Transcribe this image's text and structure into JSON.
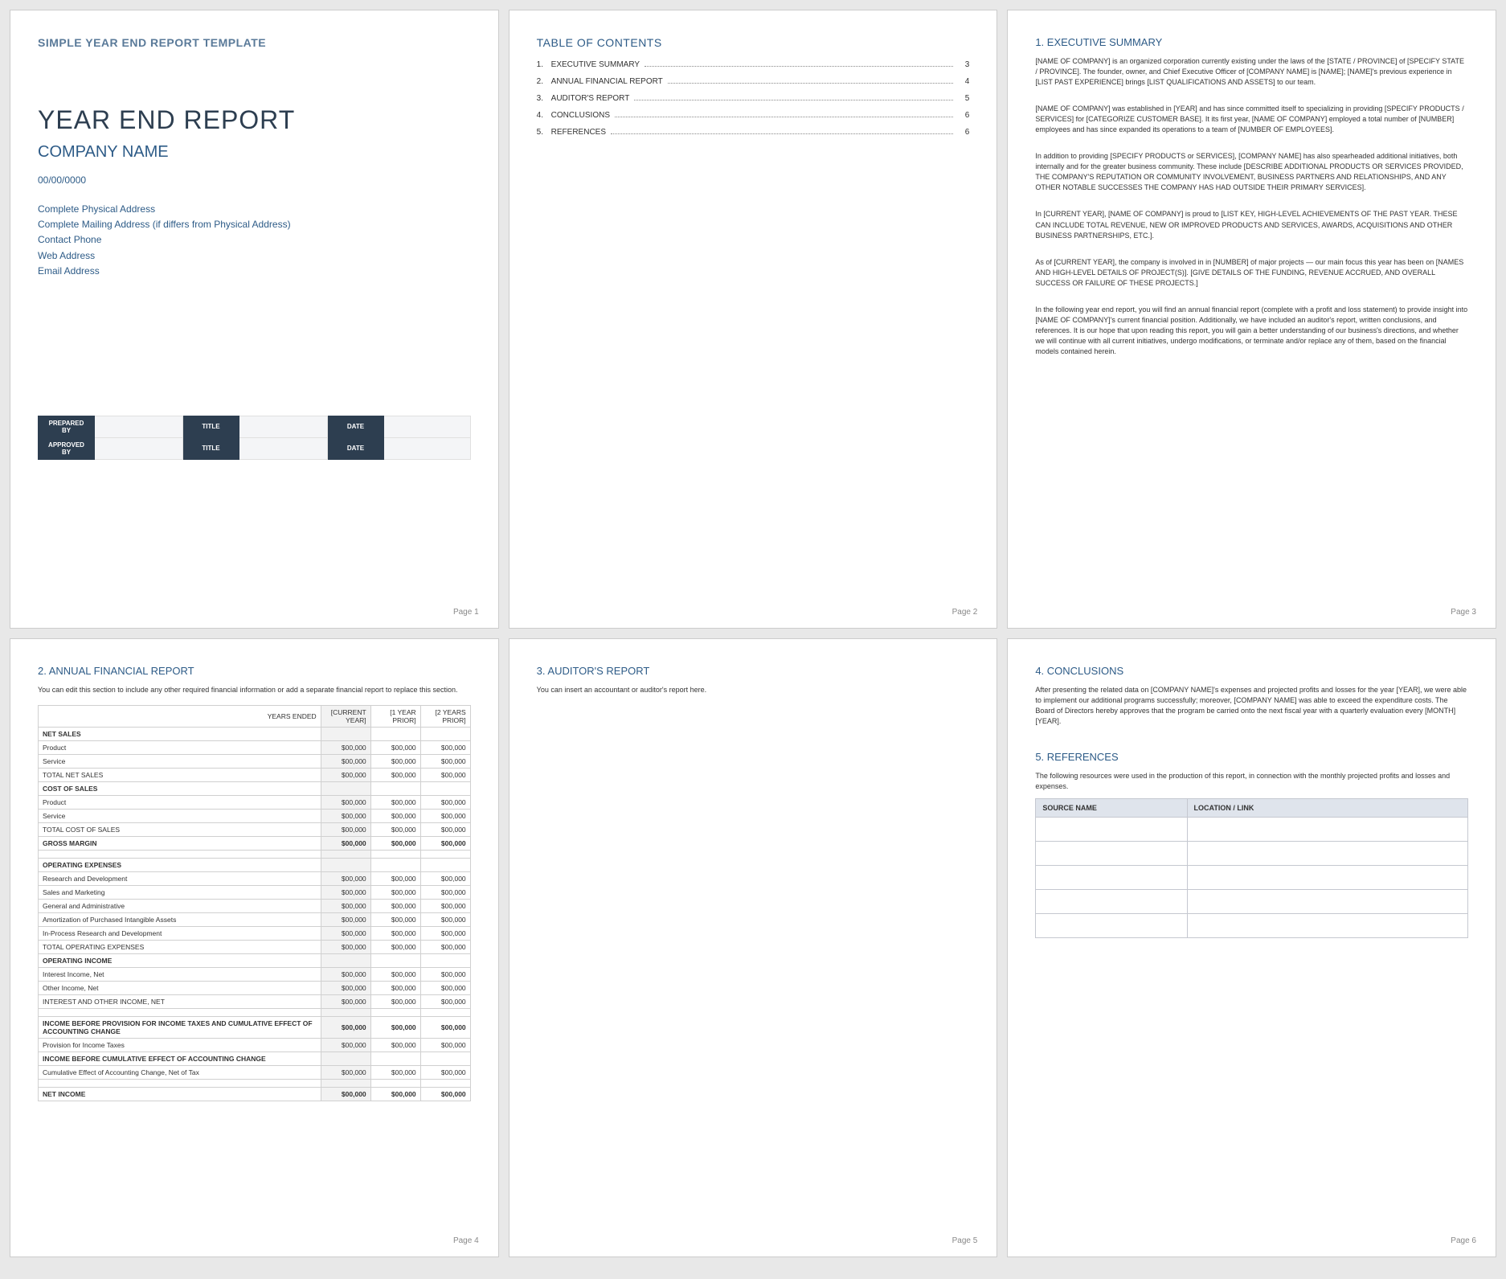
{
  "page_labels": {
    "p1": "Page 1",
    "p2": "Page 2",
    "p3": "Page 3",
    "p4": "Page 4",
    "p5": "Page 5",
    "p6": "Page 6"
  },
  "page1": {
    "template_header": "SIMPLE YEAR END REPORT TEMPLATE",
    "title": "YEAR END REPORT",
    "company": "COMPANY NAME",
    "date": "00/00/0000",
    "addr1": "Complete Physical Address",
    "addr2": "Complete Mailing Address (if differs from Physical Address)",
    "addr3": "Contact Phone",
    "addr4": "Web Address",
    "addr5": "Email Address",
    "meta": {
      "prepared_by": "PREPARED BY",
      "approved_by": "APPROVED BY",
      "title": "TITLE",
      "date": "DATE"
    }
  },
  "page2": {
    "heading": "TABLE OF CONTENTS",
    "items": [
      {
        "num": "1.",
        "txt": "EXECUTIVE SUMMARY",
        "pg": "3"
      },
      {
        "num": "2.",
        "txt": "ANNUAL FINANCIAL REPORT",
        "pg": "4"
      },
      {
        "num": "3.",
        "txt": "AUDITOR'S REPORT",
        "pg": "5"
      },
      {
        "num": "4.",
        "txt": "CONCLUSIONS",
        "pg": "6"
      },
      {
        "num": "5.",
        "txt": "REFERENCES",
        "pg": "6"
      }
    ]
  },
  "page3": {
    "heading": "1. EXECUTIVE SUMMARY",
    "p1": "[NAME OF COMPANY] is an organized corporation currently existing under the laws of the [STATE / PROVINCE] of [SPECIFY STATE / PROVINCE]. The founder, owner, and Chief Executive Officer of [COMPANY NAME] is [NAME]; [NAME]'s previous experience in [LIST PAST EXPERIENCE] brings [LIST QUALIFICATIONS AND ASSETS] to our team.",
    "p2": "[NAME OF COMPANY] was established in [YEAR] and has since committed itself to specializing in providing [SPECIFY PRODUCTS / SERVICES] for [CATEGORIZE CUSTOMER BASE]. It its first year, [NAME OF COMPANY] employed a total number of [NUMBER] employees and has since expanded its operations to a team of [NUMBER OF EMPLOYEES].",
    "p3": "In addition to providing [SPECIFY PRODUCTS or SERVICES], [COMPANY NAME] has also spearheaded additional initiatives, both internally and for the greater business community. These include [DESCRIBE ADDITIONAL PRODUCTS OR SERVICES PROVIDED, THE COMPANY'S REPUTATION OR COMMUNITY INVOLVEMENT, BUSINESS PARTNERS AND RELATIONSHIPS, AND ANY OTHER NOTABLE SUCCESSES THE COMPANY HAS HAD OUTSIDE THEIR PRIMARY SERVICES].",
    "p4": "In [CURRENT YEAR], [NAME OF COMPANY] is proud to [LIST KEY, HIGH-LEVEL ACHIEVEMENTS OF THE PAST YEAR. THESE CAN INCLUDE TOTAL REVENUE, NEW OR IMPROVED PRODUCTS AND SERVICES, AWARDS, ACQUISITIONS AND OTHER BUSINESS PARTNERSHIPS, ETC.].",
    "p5": "As of [CURRENT YEAR], the company is involved in in [NUMBER] of major projects — our main focus this year has been on [NAMES AND HIGH-LEVEL DETAILS OF PROJECT(S)]. [GIVE DETAILS OF THE FUNDING, REVENUE ACCRUED, AND OVERALL SUCCESS OR FAILURE OF THESE PROJECTS.]",
    "p6": "In the following year end report, you will find an annual financial report (complete with a profit and loss statement) to provide insight into [NAME OF COMPANY]'s current financial position. Additionally, we have included an auditor's report, written conclusions, and references. It is our hope that upon reading this report, you will gain a better understanding of our business's directions, and whether we will continue with all current initiatives, undergo modifications, or terminate and/or replace any of them, based on the financial models contained herein."
  },
  "page4": {
    "heading": "2. ANNUAL FINANCIAL REPORT",
    "note": "You can edit this section to include any other required financial information or add a separate financial report to replace this section.",
    "headers": {
      "years_ended": "YEARS ENDED",
      "current": "[CURRENT YEAR]",
      "prior1": "[1 YEAR PRIOR]",
      "prior2": "[2 YEARS PRIOR]"
    },
    "rows": {
      "net_sales": "NET SALES",
      "product": "Product",
      "service": "Service",
      "total_net_sales": "TOTAL NET SALES",
      "cost_of_sales": "COST OF SALES",
      "total_cost_of_sales": "TOTAL COST OF SALES",
      "gross_margin": "GROSS MARGIN",
      "operating_expenses": "OPERATING EXPENSES",
      "rnd": "Research and Development",
      "sales_marketing": "Sales and Marketing",
      "general_admin": "General and Administrative",
      "amortization": "Amortization of Purchased Intangible Assets",
      "inprocess_rnd": "In-Process Research and Development",
      "total_opex": "TOTAL OPERATING EXPENSES",
      "operating_income": "OPERATING INCOME",
      "interest_income": "Interest Income, Net",
      "other_income": "Other Income, Net",
      "interest_other": "INTEREST AND OTHER INCOME, NET",
      "income_before_provision": "INCOME BEFORE PROVISION FOR INCOME TAXES AND CUMULATIVE EFFECT OF ACCOUNTING CHANGE",
      "provision_taxes": "Provision for Income Taxes",
      "income_before_cumulative": "INCOME BEFORE CUMULATIVE EFFECT OF ACCOUNTING CHANGE",
      "cumulative_effect": "Cumulative Effect of Accounting Change, Net of Tax",
      "net_income": "NET INCOME"
    },
    "v": "$00,000"
  },
  "page5": {
    "heading": "3. AUDITOR'S REPORT",
    "note": "You can insert an accountant or auditor's report here."
  },
  "page6": {
    "conclusions_heading": "4. CONCLUSIONS",
    "conclusions_text": "After presenting the related data on [COMPANY NAME]'s expenses and projected profits and losses for the year [YEAR], we were able to implement our additional programs successfully; moreover, [COMPANY NAME] was able to exceed the expenditure costs. The Board of Directors hereby approves that the program be carried onto the next fiscal year with a quarterly evaluation every [MONTH] [YEAR].",
    "references_heading": "5. REFERENCES",
    "references_text": "The following resources were used in the production of this report, in connection with the monthly projected profits and losses and expenses.",
    "ref_headers": {
      "source": "SOURCE NAME",
      "location": "LOCATION / LINK"
    }
  }
}
